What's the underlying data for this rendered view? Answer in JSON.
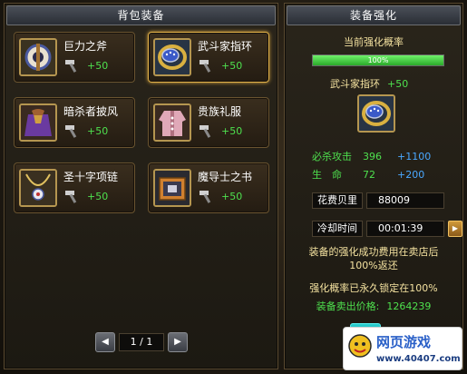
{
  "left_panel": {
    "title": "背包装备",
    "items": [
      {
        "name": "巨力之斧",
        "bonus": "+50",
        "icon": "axe-icon"
      },
      {
        "name": "武斗家指环",
        "bonus": "+50",
        "icon": "ring-icon",
        "selected": true
      },
      {
        "name": "暗杀者披风",
        "bonus": "+50",
        "icon": "cloak-icon"
      },
      {
        "name": "贵族礼服",
        "bonus": "+50",
        "icon": "robe-icon"
      },
      {
        "name": "圣十字项链",
        "bonus": "+50",
        "icon": "necklace-icon"
      },
      {
        "name": "魔导士之书",
        "bonus": "+50",
        "icon": "book-icon"
      }
    ],
    "pager": {
      "display": "1 / 1",
      "prev": "◀",
      "next": "▶"
    }
  },
  "right_panel": {
    "title": "装备强化",
    "rate_label": "当前强化概率",
    "rate_percent": 100,
    "rate_text": "100%",
    "target_name": "武斗家指环",
    "target_bonus": "+50",
    "stats": [
      {
        "label": "必杀攻击",
        "value": "396",
        "inc": "+1100"
      },
      {
        "label": "生　命",
        "value": "72",
        "inc": "+200"
      }
    ],
    "cost_label": "花费贝里",
    "cost_value": "88009",
    "cooldown_label": "冷却时间",
    "cooldown_value": "00:01:39",
    "speed_btn": "▶",
    "ff_icon": "»",
    "note_line1": "装备的强化成功费用在卖店后",
    "note_line2": "100%返还",
    "locked_note": "强化概率已永久锁定在100%",
    "sell_label": "装备卖出价格:",
    "sell_value": "1264239"
  },
  "watermark": {
    "text": "网页游戏",
    "url": "www.40407.com"
  },
  "colors": {
    "accent_green": "#4ee04e",
    "accent_blue": "#4aa8ff",
    "gold_border": "#e2b24a",
    "cream_text": "#f4e2a0"
  }
}
